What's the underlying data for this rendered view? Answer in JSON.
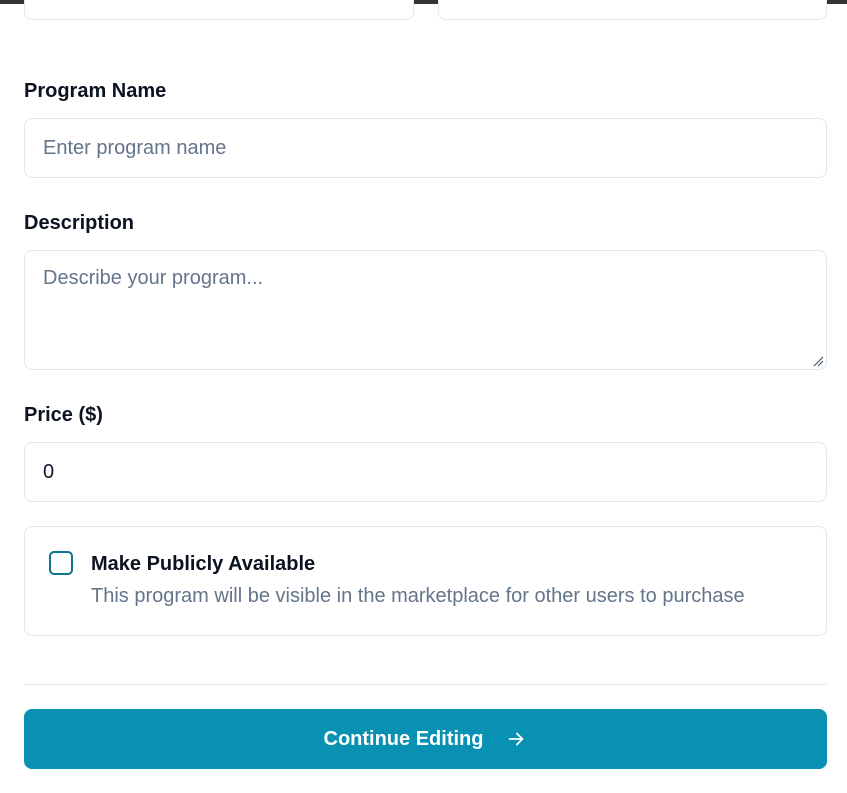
{
  "form": {
    "program_name": {
      "label": "Program Name",
      "placeholder": "Enter program name",
      "value": ""
    },
    "description": {
      "label": "Description",
      "placeholder": "Describe your program...",
      "value": ""
    },
    "price": {
      "label": "Price ($)",
      "value": "0"
    },
    "public": {
      "title": "Make Publicly Available",
      "description": "This program will be visible in the marketplace for other users to purchase",
      "checked": false
    }
  },
  "actions": {
    "continue_label": "Continue Editing",
    "continue_icon": "arrow-right-icon"
  },
  "colors": {
    "accent": "#0891b2",
    "checkbox_border": "#0e7490",
    "border": "#e2e8f0",
    "placeholder": "#64748b"
  }
}
